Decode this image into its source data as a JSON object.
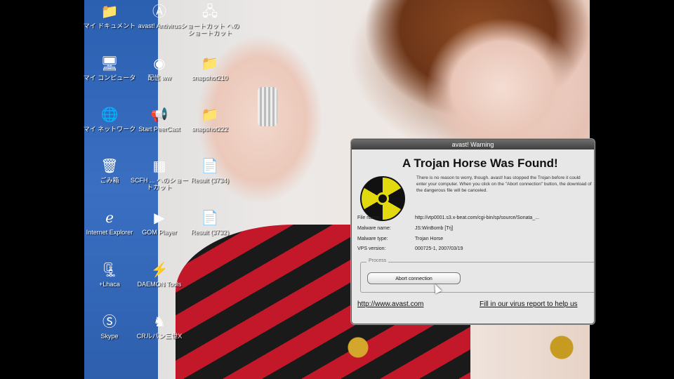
{
  "desktop": {
    "icons": [
      {
        "label": "マイ ドキュメント",
        "glyph": "📁",
        "icon": "folder-documents-icon"
      },
      {
        "label": "avast! Antivirus",
        "glyph": "Ⓐ",
        "icon": "avast-icon"
      },
      {
        "label": "ショートカット へのショートカット",
        "glyph": "🖧",
        "icon": "shortcut-icon"
      },
      {
        "label": "マイ コンピュータ",
        "glyph": "🖥",
        "icon": "my-computer-icon"
      },
      {
        "label": "配信 ww",
        "glyph": "◉",
        "icon": "broadcast-icon"
      },
      {
        "label": "snapshot210",
        "glyph": "📁",
        "icon": "folder-icon"
      },
      {
        "label": "マイ ネットワーク",
        "glyph": "🌐",
        "icon": "my-network-icon"
      },
      {
        "label": "Start PeerCast",
        "glyph": "📢",
        "icon": "peercast-icon"
      },
      {
        "label": "snapshot222",
        "glyph": "📁",
        "icon": "folder-icon"
      },
      {
        "label": "ごみ箱",
        "glyph": "🗑",
        "icon": "recycle-bin-icon"
      },
      {
        "label": "SCFH ... へのショートカット",
        "glyph": "▦",
        "icon": "scfh-icon"
      },
      {
        "label": "Result (3734)",
        "glyph": "📄",
        "icon": "result-file-icon"
      },
      {
        "label": "Internet Explorer",
        "glyph": "ℯ",
        "icon": "internet-explorer-icon"
      },
      {
        "label": "GOM Player",
        "glyph": "▶",
        "icon": "gom-player-icon"
      },
      {
        "label": "Result (3732)",
        "glyph": "📄",
        "icon": "result-file-icon"
      },
      {
        "label": "+Lhaca",
        "glyph": "🗜",
        "icon": "lhaca-icon"
      },
      {
        "label": "DAEMON Tools",
        "glyph": "⚡",
        "icon": "daemon-tools-icon"
      },
      {
        "label": "Skype",
        "glyph": "Ⓢ",
        "icon": "skype-icon"
      },
      {
        "label": "CRルパン三世X",
        "glyph": "♞",
        "icon": "cr-lupin-icon"
      }
    ]
  },
  "dialog": {
    "title": "avast! Warning",
    "heading": "A Trojan Horse Was Found!",
    "description": "There is no reason to worry, though. avast! has stopped the Trojan before it could enter your computer. When you click on the \"Abort connection\" button, the download of the dangerous file will be canceled.",
    "rows": [
      {
        "key": "File name:",
        "value": "http://vtp0001.s3.x-beat.com/cgi-bin/sp/source/Sonata_..."
      },
      {
        "key": "Malware name:",
        "value": "JS:WinBomb [Trj]"
      },
      {
        "key": "Malware type:",
        "value": "Trojan Horse"
      },
      {
        "key": "VPS version:",
        "value": "000725-1, 2007/03/19"
      }
    ],
    "process_legend": "Process",
    "abort_label": "Abort connection",
    "link_left": "http://www.avast.com",
    "link_right": "Fill in our virus report to help us"
  }
}
